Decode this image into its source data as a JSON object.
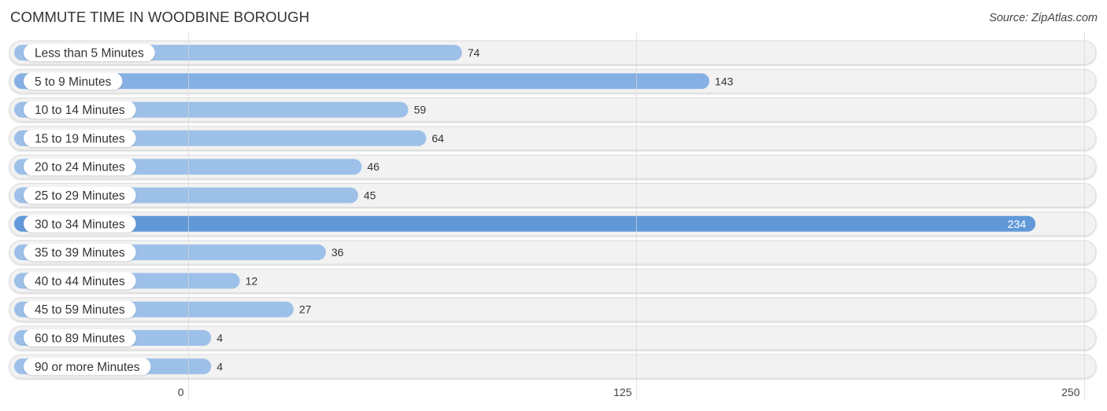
{
  "header": {
    "title": "COMMUTE TIME IN WOODBINE BOROUGH",
    "source": "Source: ZipAtlas.com"
  },
  "colors": {
    "bar_normal": "#9dc0e8",
    "bar_mid": "#86b0e3",
    "bar_highlight": "#6199d8",
    "track": "#f2f2f2",
    "track_border": "#dcdcdc",
    "grid": "#d8d8d8"
  },
  "chart_data": {
    "type": "bar",
    "orientation": "horizontal",
    "title": "COMMUTE TIME IN WOODBINE BOROUGH",
    "source": "Source: ZipAtlas.com",
    "xlabel": "",
    "ylabel": "",
    "categories": [
      "Less than 5 Minutes",
      "5 to 9 Minutes",
      "10 to 14 Minutes",
      "15 to 19 Minutes",
      "20 to 24 Minutes",
      "25 to 29 Minutes",
      "30 to 34 Minutes",
      "35 to 39 Minutes",
      "40 to 44 Minutes",
      "45 to 59 Minutes",
      "60 to 89 Minutes",
      "90 or more Minutes"
    ],
    "values": [
      74,
      143,
      59,
      64,
      46,
      45,
      234,
      36,
      12,
      27,
      4,
      4
    ],
    "xlim": [
      0,
      250
    ],
    "xticks": [
      0,
      125,
      250
    ],
    "xtick_labels": [
      "0",
      "125",
      "250"
    ],
    "grid": true,
    "highlight_max": true,
    "legend": "none"
  }
}
